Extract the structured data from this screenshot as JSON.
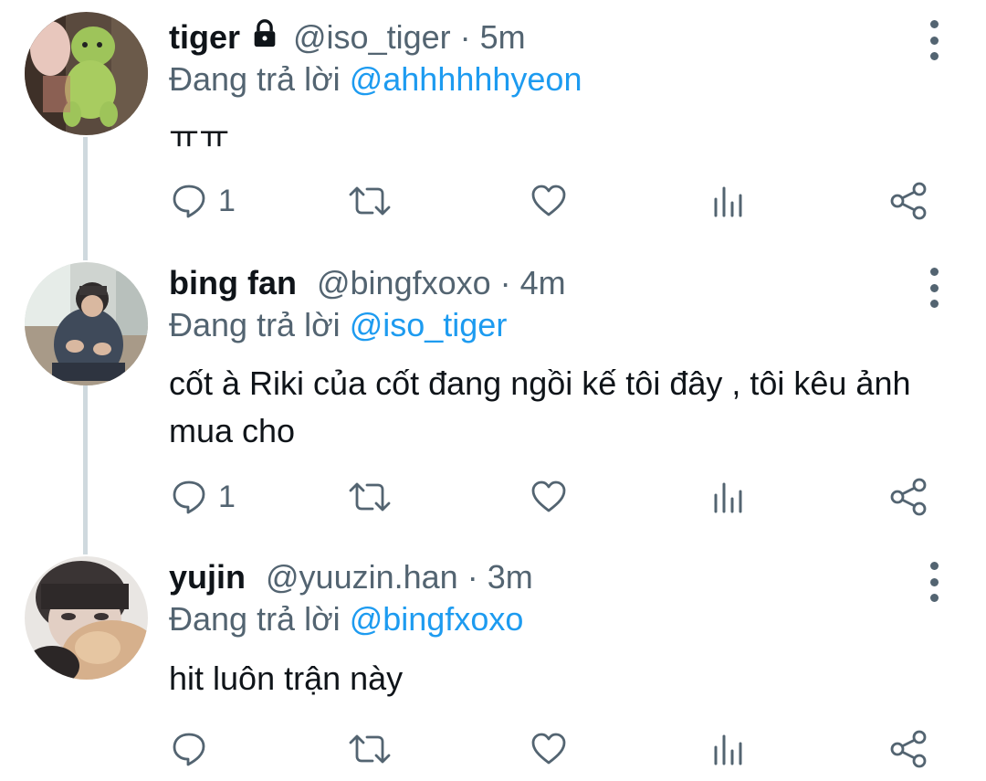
{
  "tweets": [
    {
      "name": "tiger",
      "protected": true,
      "handle": "@iso_tiger",
      "separator": "·",
      "time": "5m",
      "reply_prefix": "Đang trả lời",
      "reply_to": "@ahhhhhhyeon",
      "text": "ㅠㅠ",
      "reply_count": "1",
      "avatar": "avatar-green-plush-toy"
    },
    {
      "name": "bing fan",
      "protected": false,
      "handle": "@bingfxoxo",
      "separator": "·",
      "time": "4m",
      "reply_prefix": "Đang trả lời",
      "reply_to": "@iso_tiger",
      "text": "cốt à Riki của cốt đang ngồi kế tôi đây , tôi kêu ảnh mua cho",
      "reply_count": "1",
      "avatar": "avatar-person-sitting"
    },
    {
      "name": "yujin",
      "protected": false,
      "handle": "@yuuzin.han",
      "separator": "·",
      "time": "3m",
      "reply_prefix": "Đang trả lời",
      "reply_to": "@bingfxoxo",
      "text": "hit luôn trận này",
      "reply_count": "",
      "avatar": "avatar-person-closeup"
    }
  ],
  "icons": [
    "lock-icon",
    "more-options-icon",
    "reply-icon",
    "retweet-icon",
    "like-icon",
    "analytics-icon",
    "share-icon"
  ],
  "colors": {
    "text_primary": "#0f1419",
    "text_secondary": "#536471",
    "mention": "#1d9bf0",
    "thread_line": "#cfd9de"
  }
}
